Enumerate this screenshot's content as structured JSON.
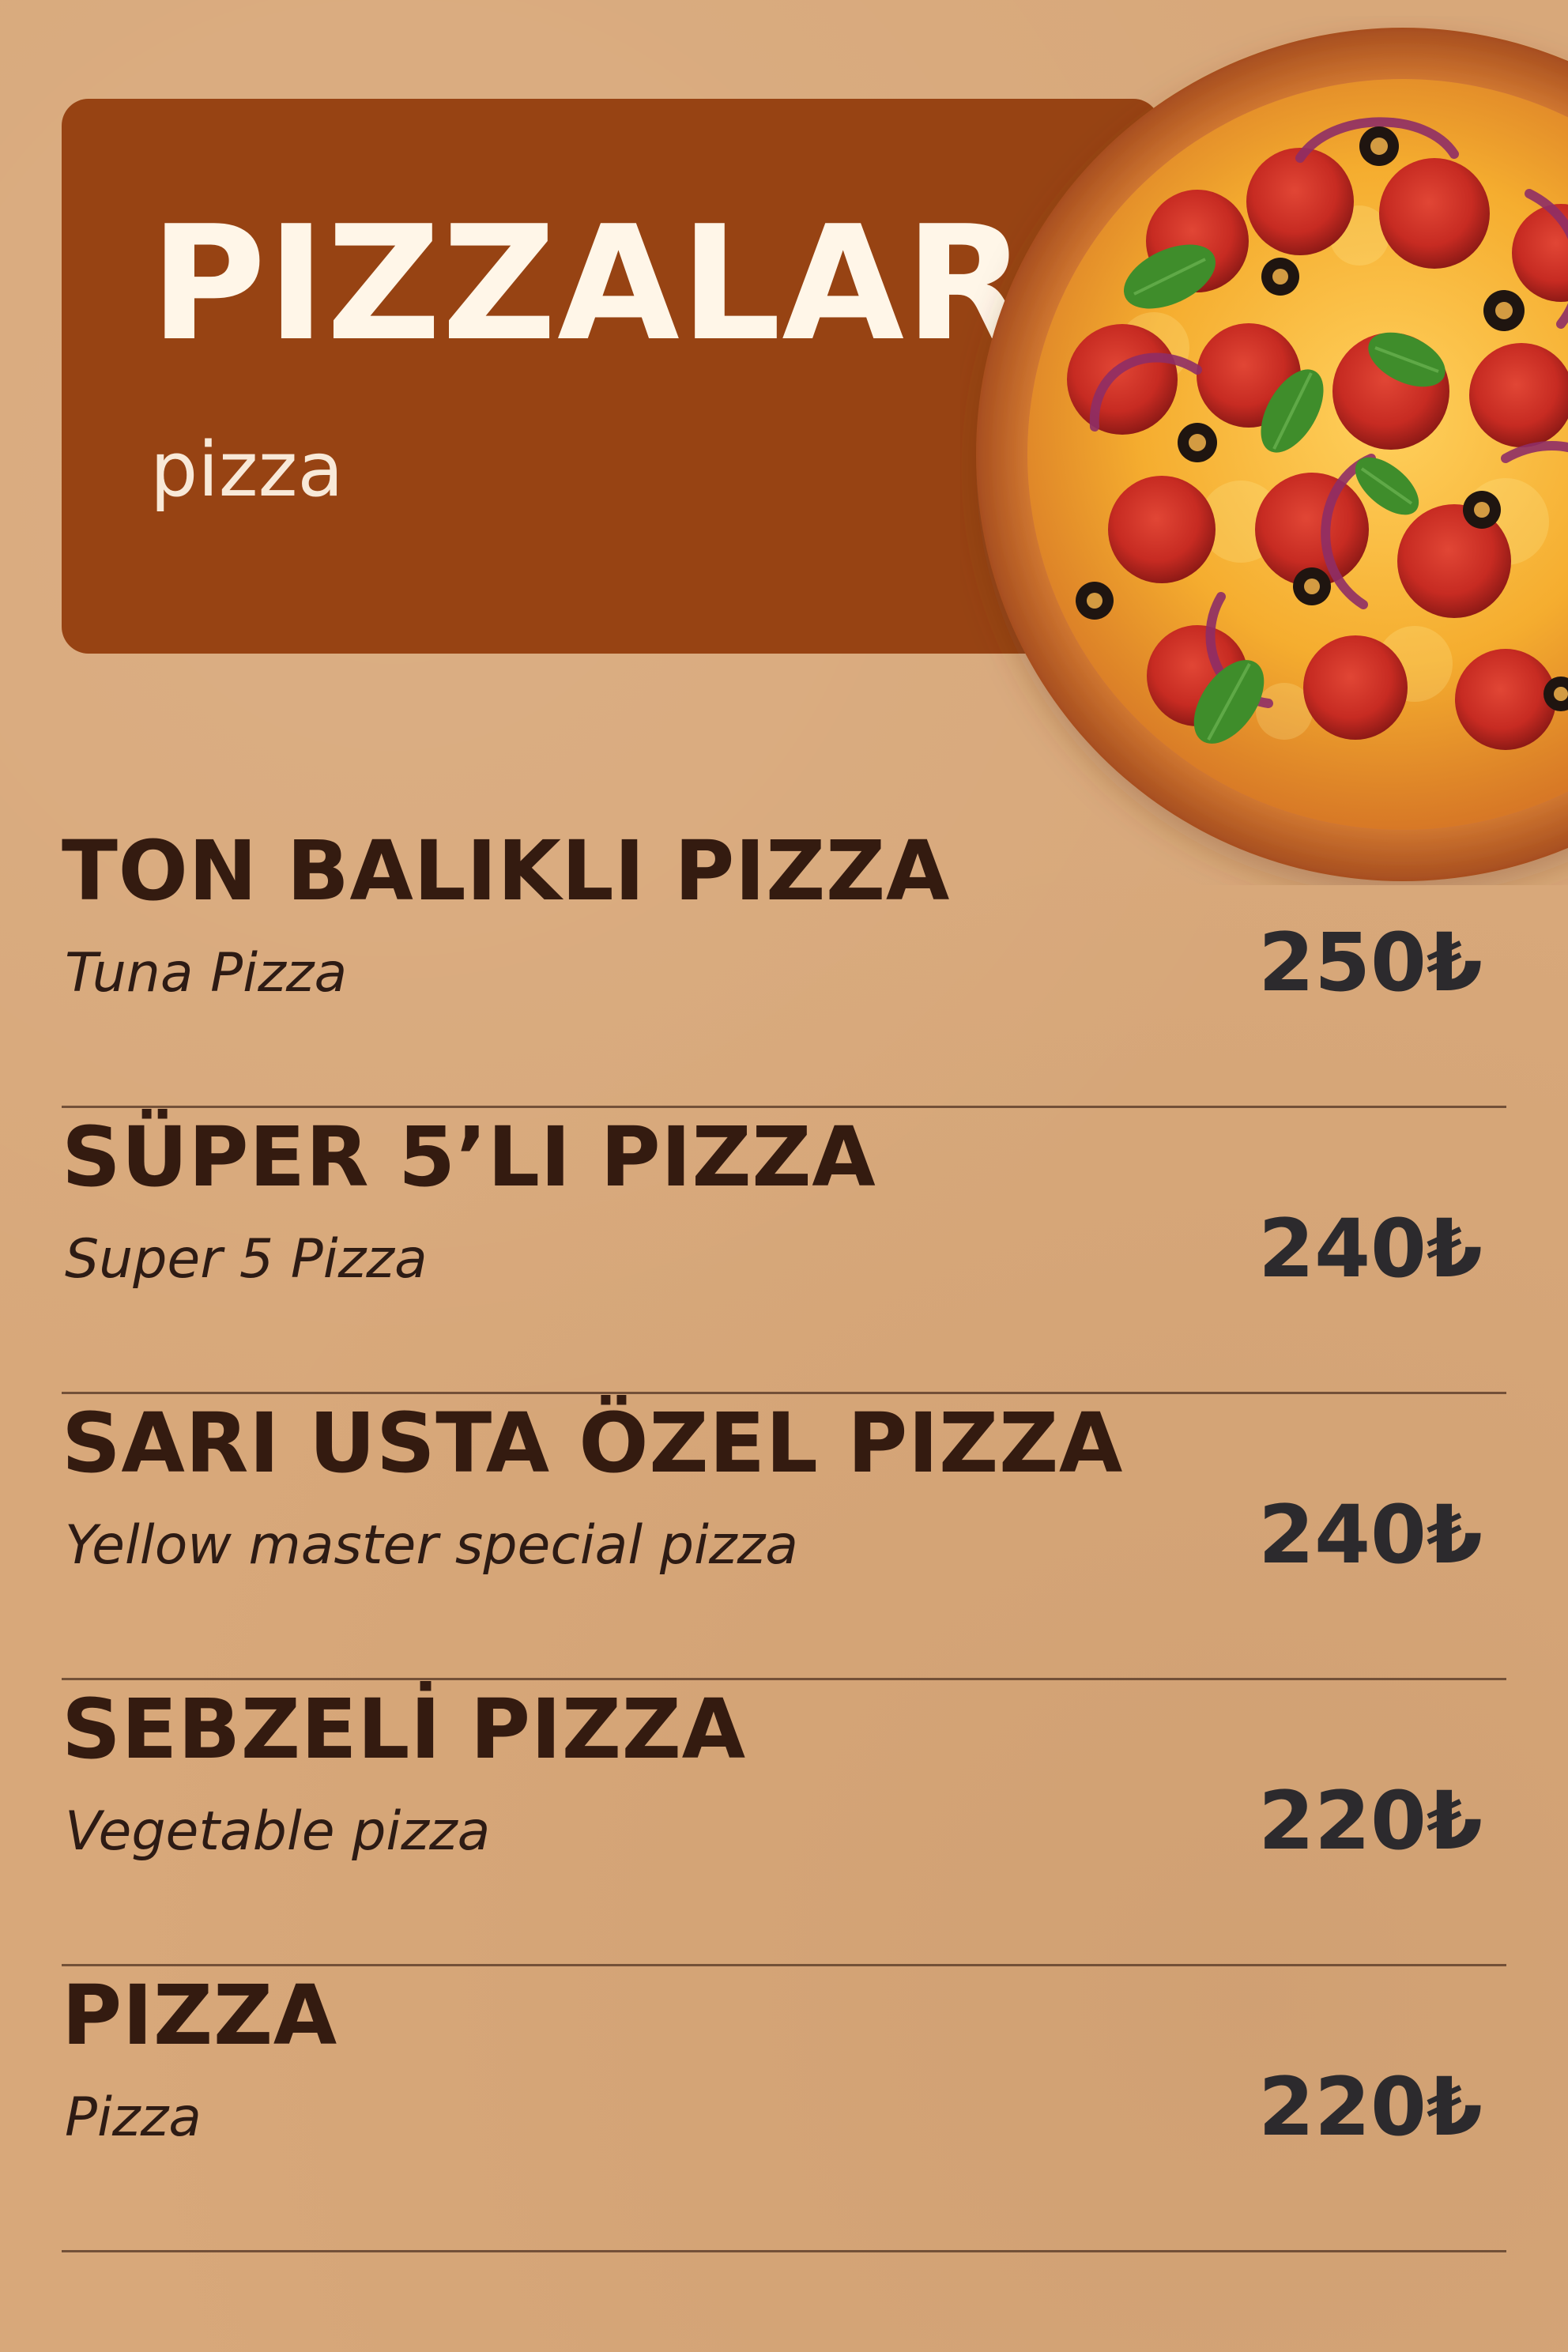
{
  "header": {
    "title": "PIZZALAR",
    "subtitle": "pizza"
  },
  "image": {
    "icon": "pepperoni-pizza-photo"
  },
  "menu": {
    "items": [
      {
        "name": "TON BALIKLI PIZZA",
        "description": "Tuna Pizza",
        "price": "250₺"
      },
      {
        "name": "SÜPER 5’LI PIZZA",
        "description": "Super 5 Pizza",
        "price": "240₺"
      },
      {
        "name": "SARI USTA ÖZEL PIZZA",
        "description": "Yellow master special pizza",
        "price": "240₺"
      },
      {
        "name": "SEBZELİ PIZZA",
        "description": "Vegetable pizza",
        "price": "220₺"
      },
      {
        "name": "PIZZA",
        "description": "Pizza",
        "price": "220₺"
      }
    ]
  },
  "colors": {
    "background": "#d8a87a",
    "header_panel": "#974313",
    "title_text": "#fff6e8",
    "item_name_text": "#341b10",
    "price_text": "#2c2a2d"
  }
}
